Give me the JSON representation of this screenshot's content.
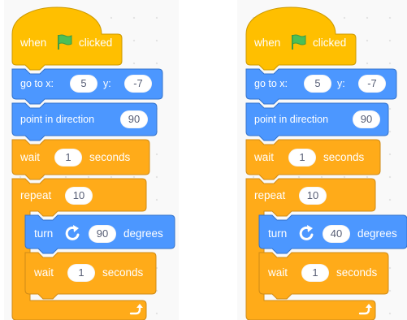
{
  "colors": {
    "events": "#ffbf00",
    "events_dark": "#cc9900",
    "motion": "#4c97ff",
    "motion_dark": "#3373cc",
    "control": "#ffab19",
    "control_dark": "#cf8b17",
    "flag": "#4cbf56"
  },
  "scripts": [
    {
      "hat": {
        "before": "when",
        "icon": "green-flag-icon",
        "after": "clicked"
      },
      "goto": {
        "label_x": "go to x:",
        "x": "5",
        "label_y": "y:",
        "y": "-7"
      },
      "point": {
        "label": "point in direction",
        "value": "90"
      },
      "wait1": {
        "label": "wait",
        "value": "1",
        "unit": "seconds"
      },
      "repeat": {
        "label": "repeat",
        "value": "10",
        "end_icon": "loop-arrow-icon"
      },
      "turn": {
        "label": "turn",
        "icon": "rotate-right-icon",
        "value": "90",
        "unit": "degrees"
      },
      "wait2": {
        "label": "wait",
        "value": "1",
        "unit": "seconds"
      }
    },
    {
      "hat": {
        "before": "when",
        "icon": "green-flag-icon",
        "after": "clicked"
      },
      "goto": {
        "label_x": "go to x:",
        "x": "5",
        "label_y": "y:",
        "y": "-7"
      },
      "point": {
        "label": "point in direction",
        "value": "90"
      },
      "wait1": {
        "label": "wait",
        "value": "1",
        "unit": "seconds"
      },
      "repeat": {
        "label": "repeat",
        "value": "10",
        "end_icon": "loop-arrow-icon"
      },
      "turn": {
        "label": "turn",
        "icon": "rotate-right-icon",
        "value": "40",
        "unit": "degrees"
      },
      "wait2": {
        "label": "wait",
        "value": "1",
        "unit": "seconds"
      }
    }
  ]
}
